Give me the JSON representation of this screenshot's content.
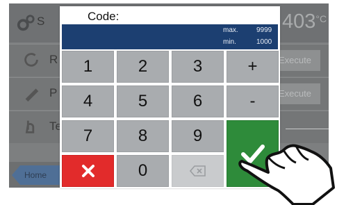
{
  "background": {
    "temperature": "403",
    "temperature_unit": "°C",
    "rows": [
      {
        "label": "R",
        "action": "Execute"
      },
      {
        "label": "P",
        "action": "Execute"
      },
      {
        "label": "Te",
        "action": ""
      }
    ],
    "home_label": "Home"
  },
  "dialog": {
    "title": "Code:",
    "max_label": "max.",
    "max_value": "9999",
    "min_label": "min.",
    "min_value": "1000",
    "value": ""
  },
  "keypad": {
    "k1": "1",
    "k2": "2",
    "k3": "3",
    "plus": "+",
    "k4": "4",
    "k5": "5",
    "k6": "6",
    "minus": "-",
    "k7": "7",
    "k8": "8",
    "k9": "9",
    "k0": "0"
  },
  "icons": {
    "cancel": "x-icon",
    "backspace": "backspace-icon",
    "confirm": "checkmark-icon",
    "hand": "pointing-hand-icon"
  },
  "colors": {
    "display": "#1c3f71",
    "cancel": "#e22b2b",
    "confirm": "#2e8b3a",
    "key": "#a9acaf"
  }
}
